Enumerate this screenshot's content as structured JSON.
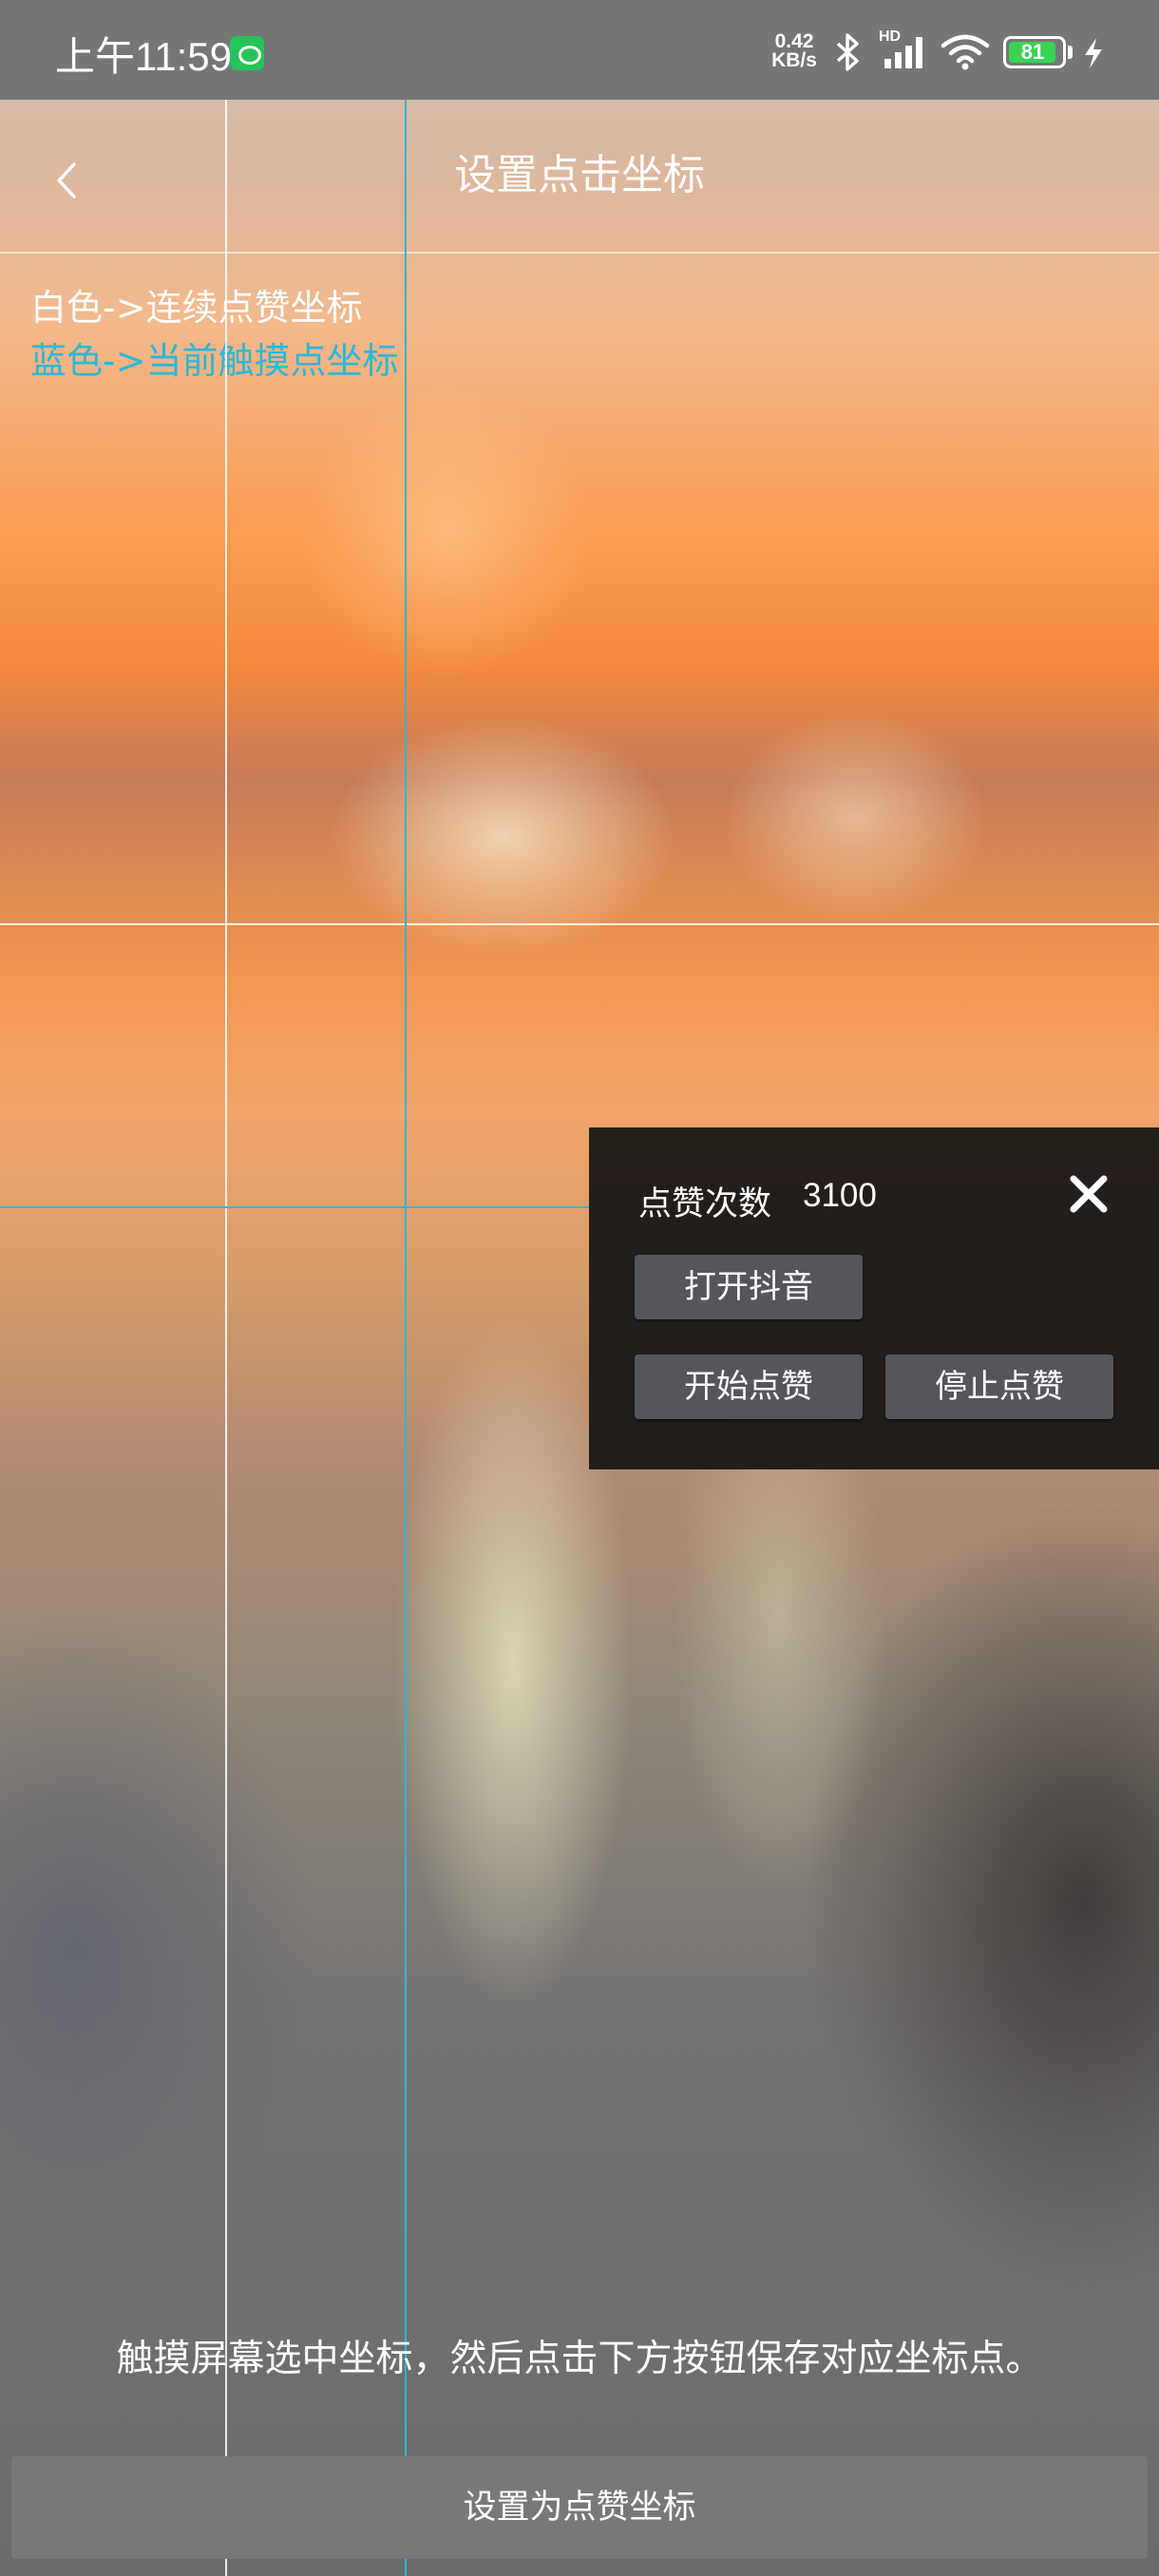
{
  "status_bar": {
    "time": "上午11:59",
    "net_speed_value": "0.42",
    "net_speed_unit": "KB/s",
    "signal_label": "HD",
    "battery_level": "81",
    "icons": [
      "app-notification-icon",
      "bluetooth-icon",
      "signal-icon",
      "wifi-icon",
      "battery-icon",
      "charging-icon"
    ]
  },
  "header": {
    "title": "设置点击坐标",
    "back_icon": "chevron-left-icon"
  },
  "legend": {
    "white_text": "白色->连续点赞坐标",
    "blue_text": "蓝色->当前触摸点坐标"
  },
  "colors": {
    "white_line": "#ffffff",
    "blue_line": "#2bb8d8",
    "panel_bg": "#161414",
    "button_bg": "#55565c"
  },
  "panel": {
    "count_label": "点赞次数",
    "count_value": "3100",
    "close_icon": "close-icon",
    "open_button": "打开抖音",
    "start_button": "开始点赞",
    "stop_button": "停止点赞"
  },
  "instruction": "触摸屏幕选中坐标，然后点击下方按钮保存对应坐标点。",
  "save_button": "设置为点赞坐标"
}
